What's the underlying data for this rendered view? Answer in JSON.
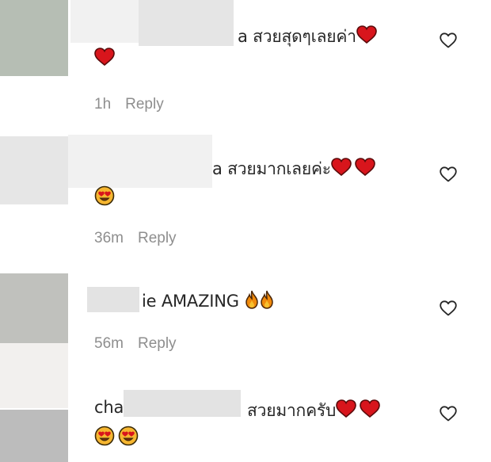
{
  "comments": [
    {
      "visible_text": "a สวยสุดๆเลยค่า",
      "time": "1h",
      "reply_label": "Reply",
      "avatar_color": "#b6beb4"
    },
    {
      "visible_text": "a สวยมากเลยค่ะ",
      "time": "36m",
      "reply_label": "Reply",
      "avatar_color": "#e6e6e6"
    },
    {
      "visible_text": "ie AMAZING",
      "time": "56m",
      "reply_label": "Reply",
      "avatar_color": "#c0c1bd"
    },
    {
      "prefix": "cha",
      "visible_text": "สวยมากครับ",
      "avatar_color": "#bcbcbc"
    }
  ],
  "icons": {
    "heart_emoji": "heart-emoji",
    "fire_emoji": "fire-emoji",
    "heart_eyes_emoji": "heart-eyes-emoji",
    "like": "heart-outline-icon"
  },
  "colors": {
    "text": "#262626",
    "muted": "#8e8e8e",
    "heart_red": "#d8151c"
  }
}
